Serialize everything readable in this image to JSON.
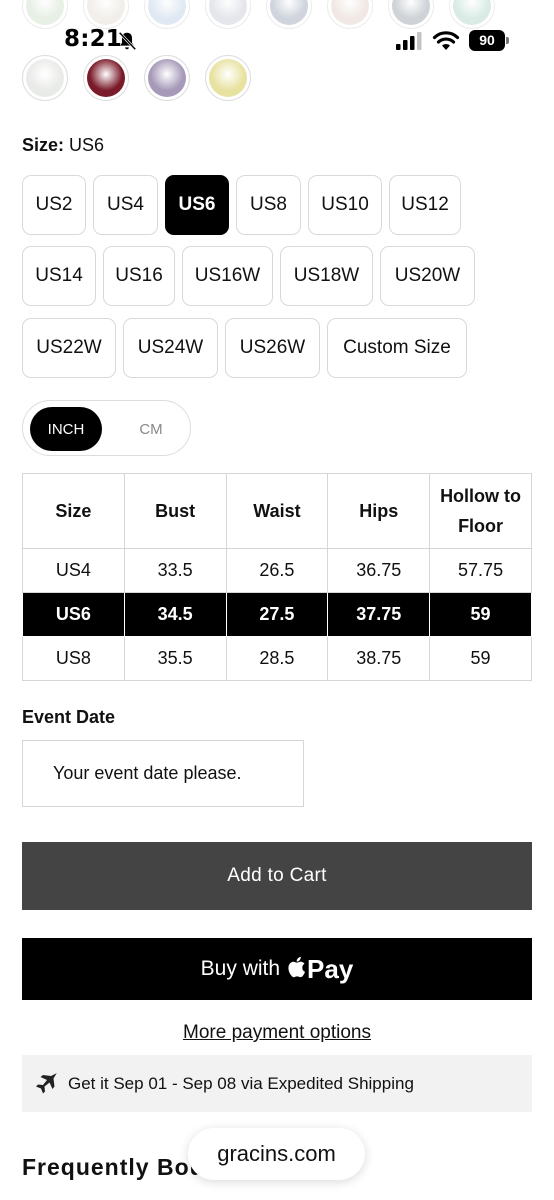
{
  "status_bar": {
    "time": "8:21",
    "battery": "90"
  },
  "swatches": {
    "top_row_colors": [
      "#d4e4d0",
      "#e8e2dc",
      "#c8d8ea",
      "#cfd3de",
      "#a9b2c2",
      "#e6d7d0",
      "#a8b0b8",
      "#bcdcd2"
    ],
    "second_row_colors": [
      "#e9ebe8",
      "#7a1b2a",
      "#a69ab8",
      "#e8e2a0"
    ]
  },
  "size_selector": {
    "label": "Size:",
    "selected_value": "US6",
    "options": [
      "US2",
      "US4",
      "US6",
      "US8",
      "US10",
      "US12",
      "US14",
      "US16",
      "US16W",
      "US18W",
      "US20W",
      "US22W",
      "US24W",
      "US26W",
      "Custom Size"
    ]
  },
  "unit_toggle": {
    "active": "INCH",
    "inactive": "CM"
  },
  "size_chart": {
    "headers": [
      "Size",
      "Bust",
      "Waist",
      "Hips",
      "Hollow to Floor"
    ],
    "rows": [
      [
        "US4",
        "33.5",
        "26.5",
        "36.75",
        "57.75"
      ],
      [
        "US6",
        "34.5",
        "27.5",
        "37.75",
        "59"
      ],
      [
        "US8",
        "35.5",
        "28.5",
        "38.75",
        "59"
      ]
    ]
  },
  "event_date": {
    "label": "Event Date",
    "placeholder": "Your event date please."
  },
  "buttons": {
    "add_to_cart": "Add to Cart",
    "buy_with": "Buy with",
    "pay": "Pay",
    "more_payment": "More payment options"
  },
  "shipping": {
    "text": "Get it Sep 01 - Sep 08 via Expedited Shipping"
  },
  "section": {
    "frequently_bought": "Frequently Bou"
  },
  "browser": {
    "url": "gracins.com"
  }
}
